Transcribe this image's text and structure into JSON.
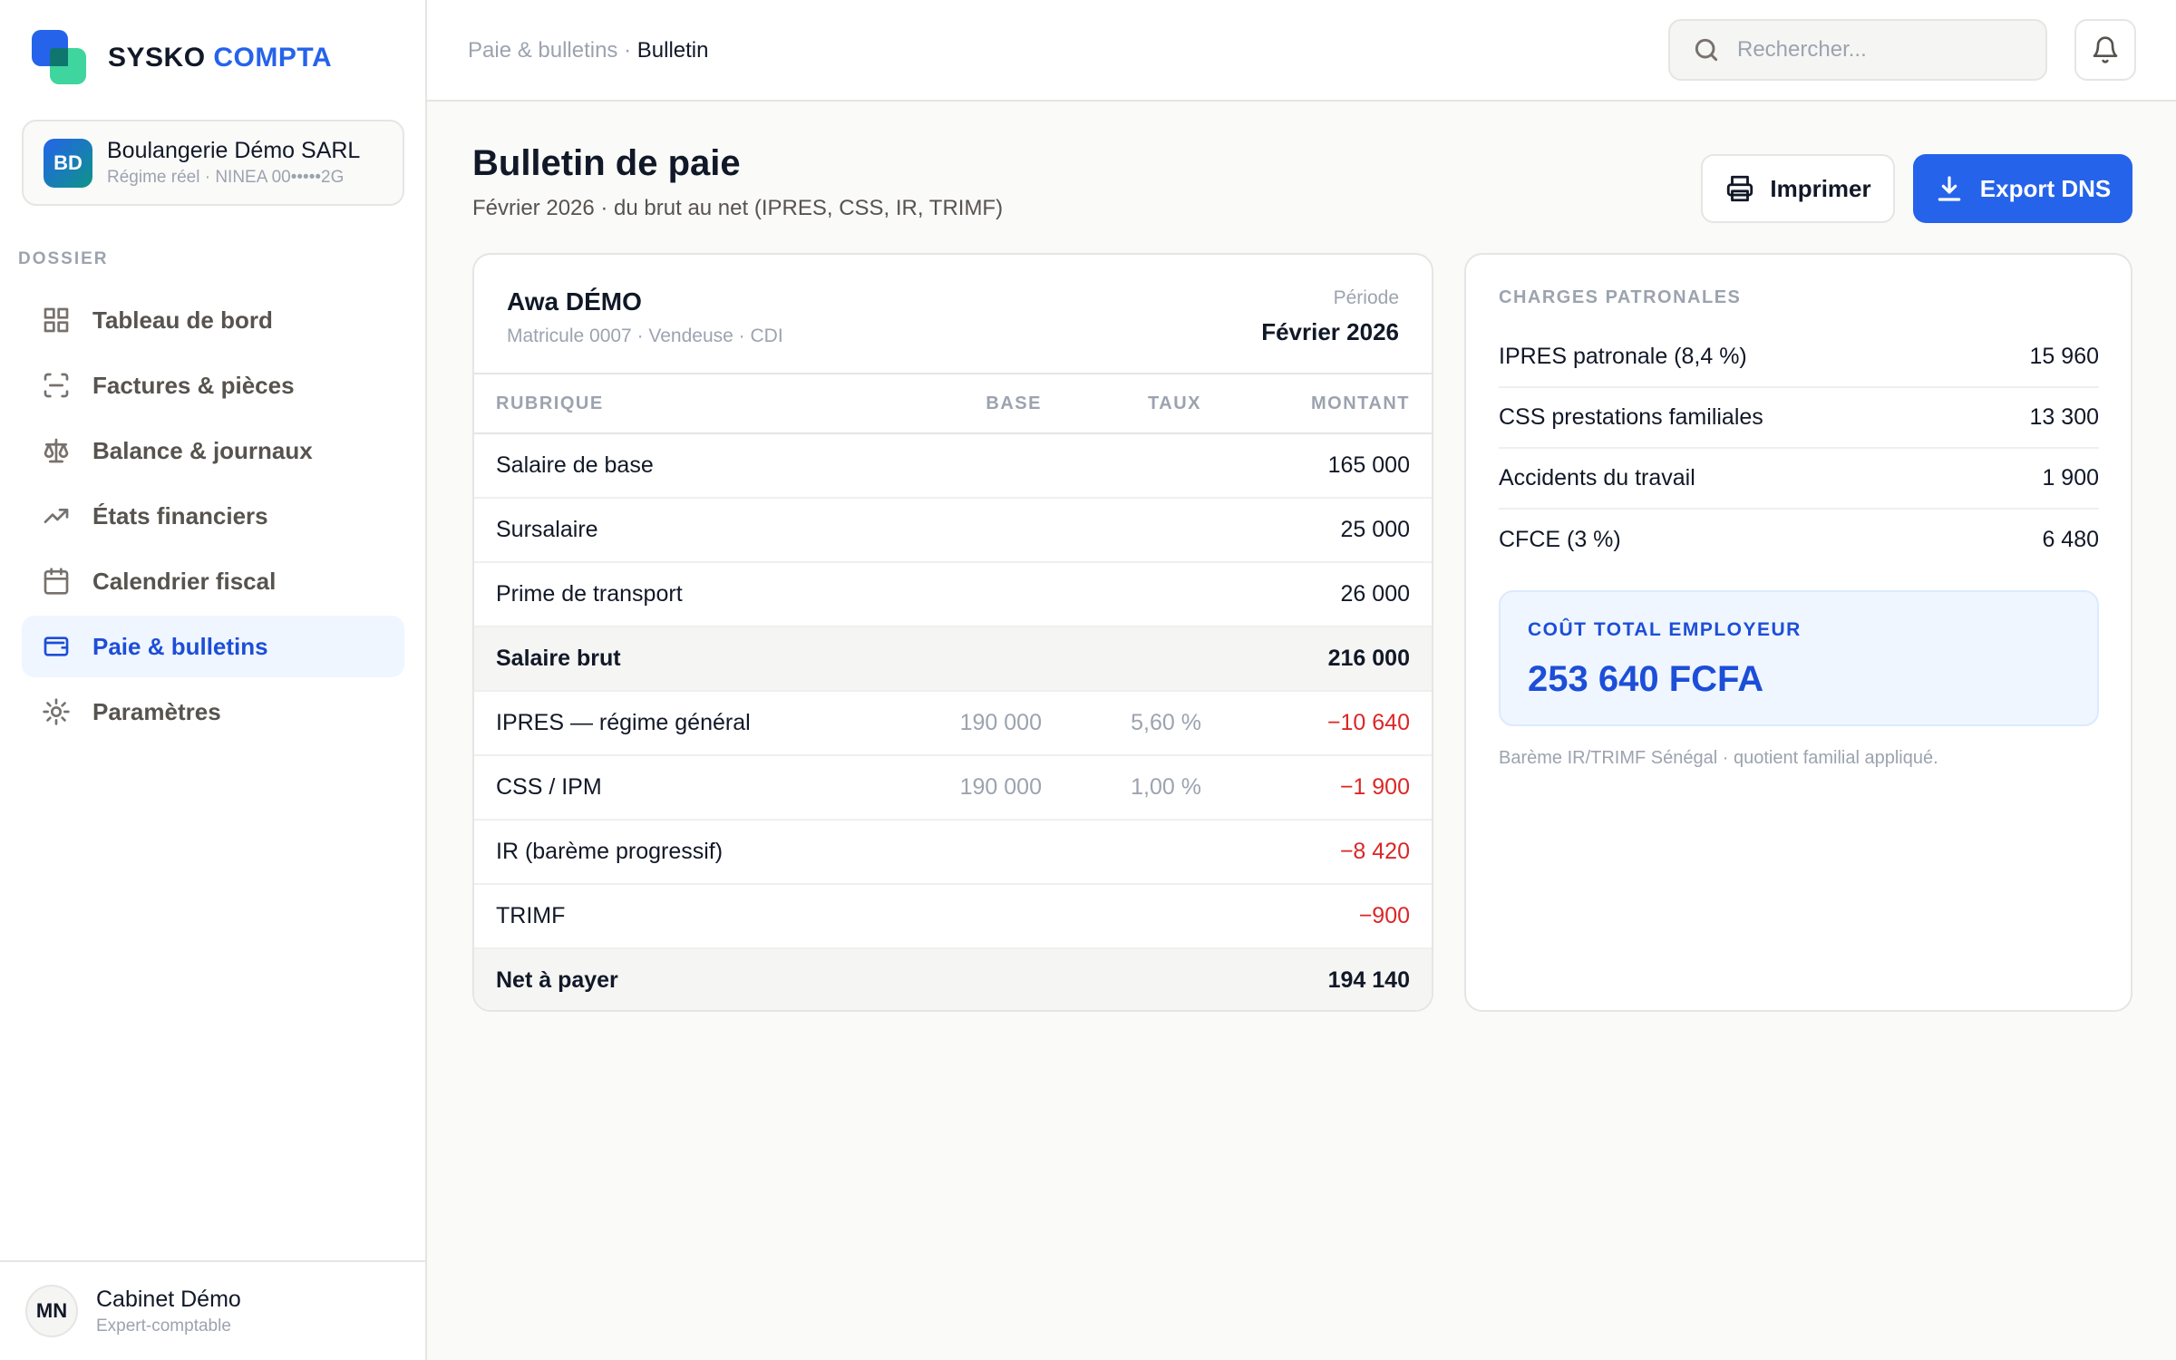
{
  "brand": {
    "part1": "SYSKO",
    "part2": "COMPTA"
  },
  "company": {
    "initials": "BD",
    "name": "Boulangerie Démo SARL",
    "subtitle": "Régime réel · NINEA 00•••••2G"
  },
  "sidebar": {
    "section_label": "DOSSIER",
    "items": [
      {
        "label": "Tableau de bord",
        "icon": "grid-icon"
      },
      {
        "label": "Factures & pièces",
        "icon": "scan-icon"
      },
      {
        "label": "Balance & journaux",
        "icon": "scale-icon"
      },
      {
        "label": "États financiers",
        "icon": "trending-up-icon"
      },
      {
        "label": "Calendrier fiscal",
        "icon": "calendar-icon"
      },
      {
        "label": "Paie & bulletins",
        "icon": "wallet-icon",
        "active": true
      },
      {
        "label": "Paramètres",
        "icon": "sun-settings-icon"
      }
    ]
  },
  "user": {
    "initials": "MN",
    "name": "Cabinet Démo",
    "role": "Expert-comptable"
  },
  "breadcrumb": {
    "parent": "Paie & bulletins",
    "separator": " · ",
    "current": "Bulletin"
  },
  "search": {
    "placeholder": "Rechercher..."
  },
  "page": {
    "title": "Bulletin de paie",
    "subtitle": "Février 2026 · du brut au net (IPRES, CSS, IR, TRIMF)"
  },
  "actions": {
    "print_label": "Imprimer",
    "export_label": "Export DNS"
  },
  "payslip": {
    "employee_name": "Awa DÉMO",
    "employee_meta": "Matricule 0007 · Vendeuse · CDI",
    "period_label": "Période",
    "period_value": "Février 2026",
    "columns": [
      "RUBRIQUE",
      "BASE",
      "TAUX",
      "MONTANT"
    ],
    "rows": [
      {
        "label": "Salaire de base",
        "base": "",
        "taux": "",
        "montant": "165 000",
        "type": "normal"
      },
      {
        "label": "Sursalaire",
        "base": "",
        "taux": "",
        "montant": "25 000",
        "type": "normal"
      },
      {
        "label": "Prime de transport",
        "base": "",
        "taux": "",
        "montant": "26 000",
        "type": "normal"
      },
      {
        "label": "Salaire brut",
        "base": "",
        "taux": "",
        "montant": "216 000",
        "type": "total"
      },
      {
        "label": "IPRES — régime général",
        "base": "190 000",
        "taux": "5,60 %",
        "montant": "−10 640",
        "type": "negative"
      },
      {
        "label": "CSS / IPM",
        "base": "190 000",
        "taux": "1,00 %",
        "montant": "−1 900",
        "type": "negative"
      },
      {
        "label": "IR (barème progressif)",
        "base": "",
        "taux": "",
        "montant": "−8 420",
        "type": "negative"
      },
      {
        "label": "TRIMF",
        "base": "",
        "taux": "",
        "montant": "−900",
        "type": "negative"
      },
      {
        "label": "Net à payer",
        "base": "",
        "taux": "",
        "montant": "194 140",
        "type": "total"
      }
    ]
  },
  "charges": {
    "title": "CHARGES PATRONALES",
    "items": [
      {
        "label": "IPRES patronale (8,4 %)",
        "value": "15 960"
      },
      {
        "label": "CSS prestations familiales",
        "value": "13 300"
      },
      {
        "label": "Accidents du travail",
        "value": "1 900"
      },
      {
        "label": "CFCE (3 %)",
        "value": "6 480"
      }
    ],
    "total_label": "COÛT TOTAL EMPLOYEUR",
    "total_value": "253 640 FCFA",
    "note": "Barème IR/TRIMF Sénégal · quotient familial appliqué."
  },
  "colors": {
    "accent": "#2563eb",
    "negative": "#dc2626",
    "active_bg": "#eff6ff"
  }
}
